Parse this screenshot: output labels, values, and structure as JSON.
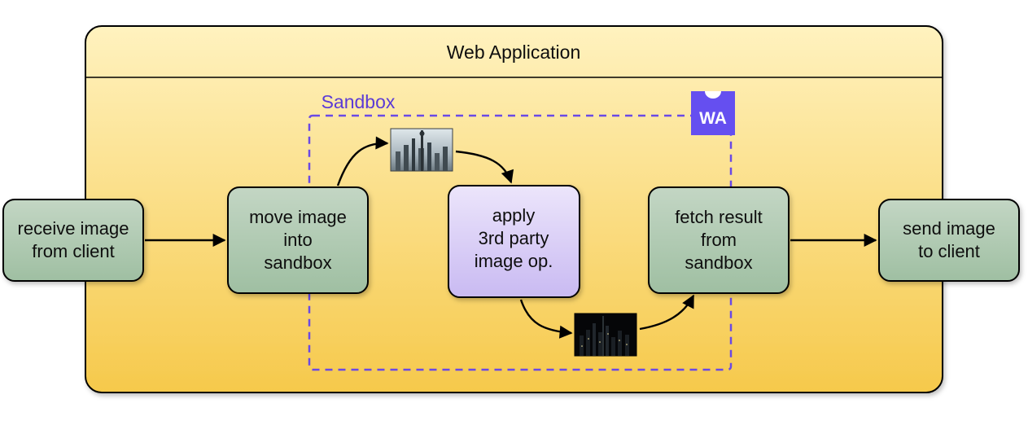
{
  "container": {
    "title": "Web Application"
  },
  "sandbox": {
    "label": "Sandbox",
    "badge": "WA"
  },
  "nodes": {
    "receive": {
      "l1": "receive image",
      "l2": "from client"
    },
    "move": {
      "l1": "move image",
      "l2": "into",
      "l3": "sandbox"
    },
    "apply": {
      "l1": "apply",
      "l2": "3rd party",
      "l3": "image op."
    },
    "fetch": {
      "l1": "fetch result",
      "l2": "from",
      "l3": "sandbox"
    },
    "send": {
      "l1": "send image",
      "l2": "to client"
    }
  },
  "images": {
    "input": {
      "name": "city-skyline-photo"
    },
    "output": {
      "name": "city-skyline-dark"
    }
  },
  "colors": {
    "containerFillTop": "#fff2bf",
    "containerFillBottom": "#f6c94b",
    "containerStroke": "#000000",
    "greenNodeFillTop": "#c3d6c4",
    "greenNodeFillBottom": "#9fbfa2",
    "greenNodeStroke": "#000000",
    "purpleNodeFillTop": "#ece5fb",
    "purpleNodeFillBottom": "#c9baf2",
    "purpleNodeStroke": "#000000",
    "sandboxStroke": "#6a49e5",
    "waBadge": "#654ff0",
    "arrow": "#000000"
  }
}
